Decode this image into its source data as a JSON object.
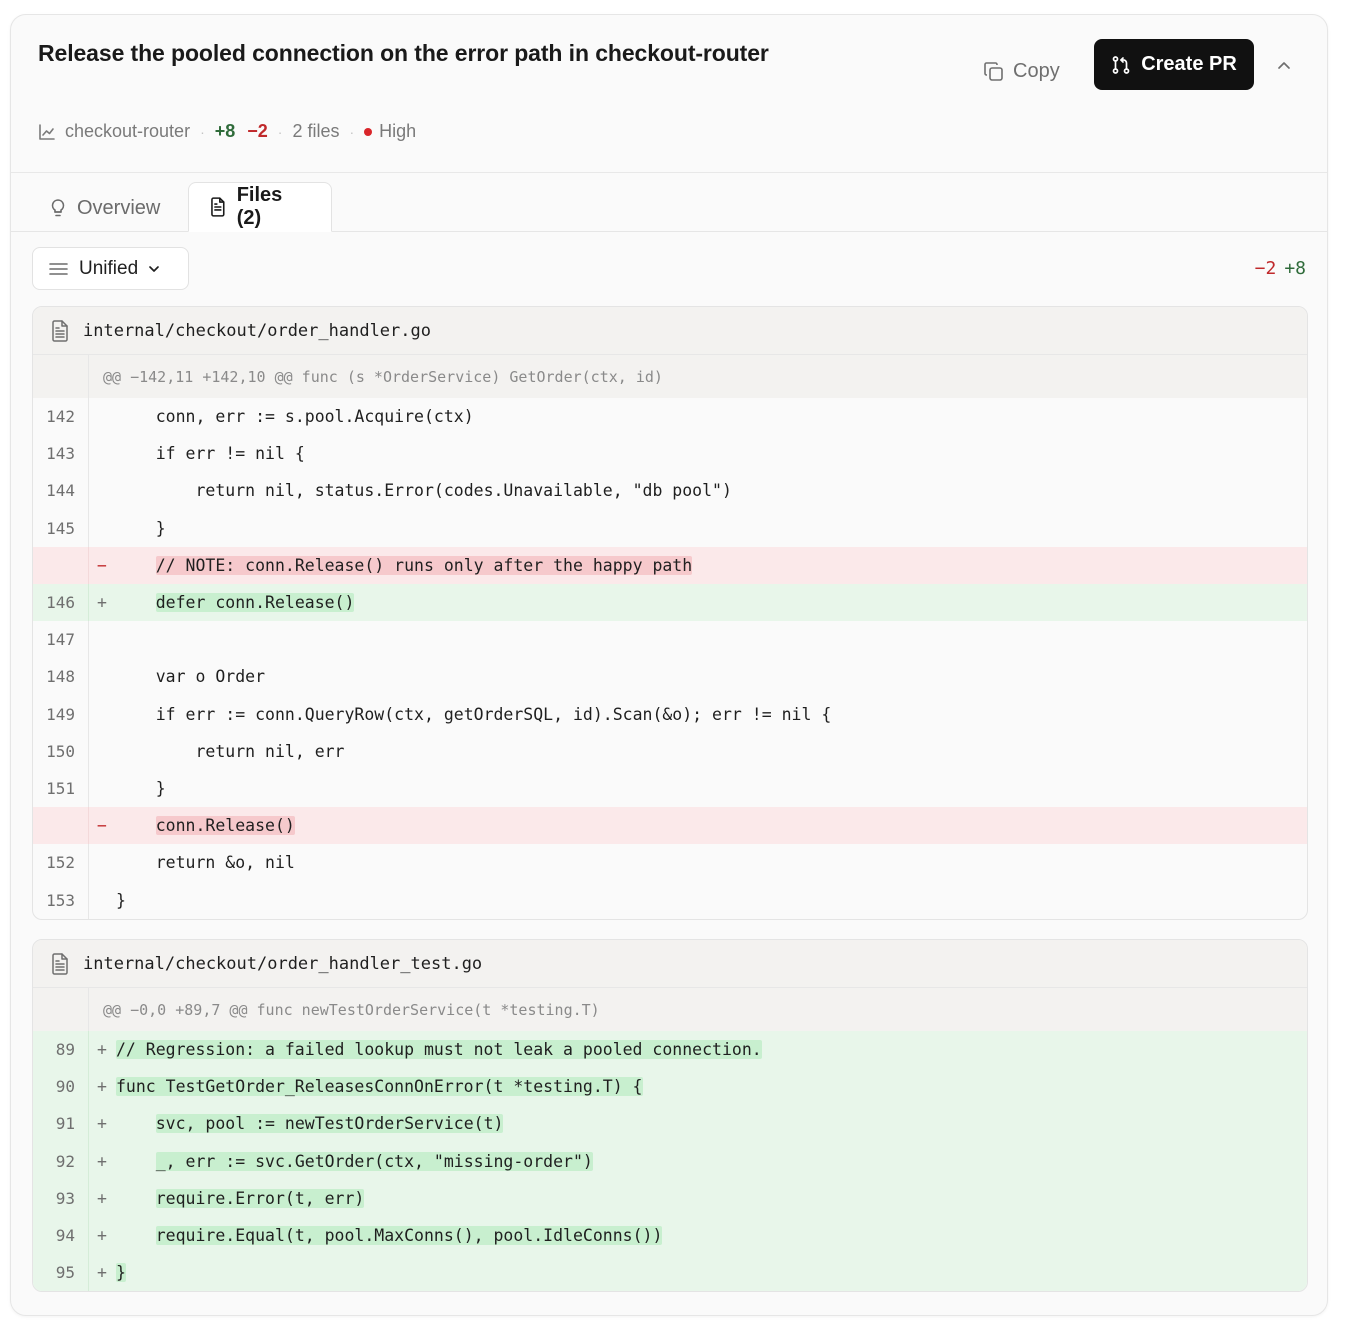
{
  "header": {
    "title": "Release the pooled connection on the error path in checkout-router",
    "repo": "checkout-router",
    "additions": "+8",
    "deletions": "−2",
    "files_count": "2 files",
    "severity": "High",
    "copy_label": "Copy",
    "create_pr_label": "Create PR"
  },
  "tabs": {
    "overview": "Overview",
    "files": "Files (2)"
  },
  "toolbar": {
    "view_mode": "Unified",
    "deletions": "−2",
    "additions": "+8"
  },
  "files": [
    {
      "path": "internal/checkout/order_handler.go",
      "hunk": "@@ −142,11 +142,10 @@ func (s *OrderService) GetOrder(ctx, id)",
      "lines": [
        {
          "num": "142",
          "sign": "",
          "type": "ctx",
          "indent": "    ",
          "code": "conn, err := s.pool.Acquire(ctx)"
        },
        {
          "num": "143",
          "sign": "",
          "type": "ctx",
          "indent": "    ",
          "code": "if err != nil {"
        },
        {
          "num": "144",
          "sign": "",
          "type": "ctx",
          "indent": "        ",
          "code": "return nil, status.Error(codes.Unavailable, \"db pool\")"
        },
        {
          "num": "145",
          "sign": "",
          "type": "ctx",
          "indent": "    ",
          "code": "}"
        },
        {
          "num": "",
          "sign": "−",
          "type": "del",
          "indent": "    ",
          "code": "// NOTE: conn.Release() runs only after the happy path"
        },
        {
          "num": "146",
          "sign": "+",
          "type": "add",
          "indent": "    ",
          "code": "defer conn.Release()"
        },
        {
          "num": "147",
          "sign": "",
          "type": "ctx",
          "indent": "",
          "code": ""
        },
        {
          "num": "148",
          "sign": "",
          "type": "ctx",
          "indent": "    ",
          "code": "var o Order"
        },
        {
          "num": "149",
          "sign": "",
          "type": "ctx",
          "indent": "    ",
          "code": "if err := conn.QueryRow(ctx, getOrderSQL, id).Scan(&o); err != nil {"
        },
        {
          "num": "150",
          "sign": "",
          "type": "ctx",
          "indent": "        ",
          "code": "return nil, err"
        },
        {
          "num": "151",
          "sign": "",
          "type": "ctx",
          "indent": "    ",
          "code": "}"
        },
        {
          "num": "",
          "sign": "−",
          "type": "del",
          "indent": "    ",
          "code": "conn.Release()"
        },
        {
          "num": "152",
          "sign": "",
          "type": "ctx",
          "indent": "    ",
          "code": "return &o, nil"
        },
        {
          "num": "153",
          "sign": "",
          "type": "ctx",
          "indent": "",
          "code": "}"
        }
      ]
    },
    {
      "path": "internal/checkout/order_handler_test.go",
      "hunk": "@@ −0,0 +89,7 @@ func newTestOrderService(t *testing.T)",
      "lines": [
        {
          "num": "89",
          "sign": "+",
          "type": "add",
          "indent": "",
          "code": "// Regression: a failed lookup must not leak a pooled connection."
        },
        {
          "num": "90",
          "sign": "+",
          "type": "add",
          "indent": "",
          "code": "func TestGetOrder_ReleasesConnOnError(t *testing.T) {"
        },
        {
          "num": "91",
          "sign": "+",
          "type": "add",
          "indent": "    ",
          "code": "svc, pool := newTestOrderService(t)"
        },
        {
          "num": "92",
          "sign": "+",
          "type": "add",
          "indent": "    ",
          "code": "_, err := svc.GetOrder(ctx, \"missing-order\")"
        },
        {
          "num": "93",
          "sign": "+",
          "type": "add",
          "indent": "    ",
          "code": "require.Error(t, err)"
        },
        {
          "num": "94",
          "sign": "+",
          "type": "add",
          "indent": "    ",
          "code": "require.Equal(t, pool.MaxConns(), pool.IdleConns())"
        },
        {
          "num": "95",
          "sign": "+",
          "type": "add",
          "indent": "",
          "code": "}"
        }
      ]
    }
  ]
}
